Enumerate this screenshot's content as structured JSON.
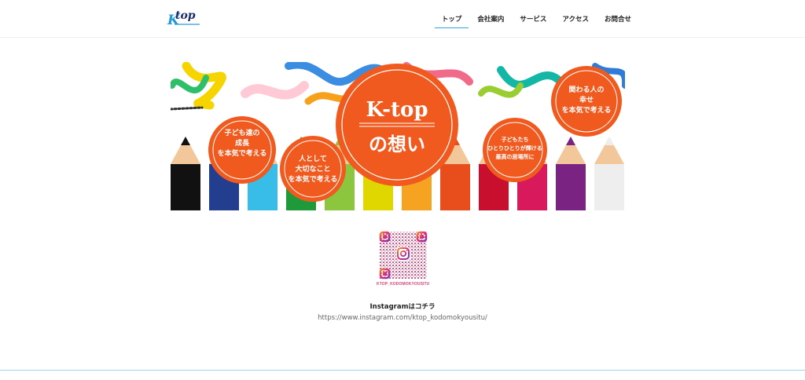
{
  "logo": {
    "text_k": "K",
    "text_top": "top"
  },
  "nav": {
    "items": [
      {
        "label": "トップ",
        "active": true
      },
      {
        "label": "会社案内",
        "active": false
      },
      {
        "label": "サービス",
        "active": false
      },
      {
        "label": "アクセス",
        "active": false
      },
      {
        "label": "お問合せ",
        "active": false
      }
    ]
  },
  "banner": {
    "main": {
      "line1": "K-top",
      "line2": "の想い"
    },
    "circle1": [
      "子ども達の",
      "成長",
      "を本気で考える"
    ],
    "circle2": [
      "人として",
      "大切なこと",
      "を本気で考える"
    ],
    "circle3": [
      "子どもたち",
      "ひとりひとりが輝ける",
      "最高の居場所に"
    ],
    "circle4": [
      "関わる人の",
      "幸せ",
      "を本気で考える"
    ],
    "accent_color": "#f05a1e"
  },
  "instagram": {
    "qr_label": "KTOP_KODOMOKYOUSITU",
    "title": "Instagramはコチラ",
    "url": "https://www.instagram.com/ktop_kodomokyousitu/"
  },
  "colors": {
    "nav_underline": "#2aa7d6",
    "footer_line": "#9bd2e6"
  }
}
